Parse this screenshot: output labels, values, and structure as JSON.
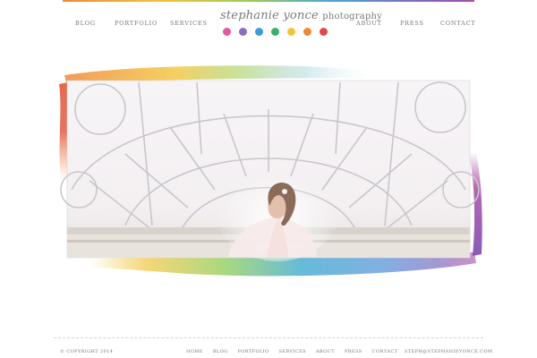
{
  "brand": {
    "name": "stephanie yonce",
    "suffix": "photography",
    "dot_colors": [
      "#e05aa0",
      "#8a6dc0",
      "#3e9ad8",
      "#39b06a",
      "#f2c43a",
      "#f0873a",
      "#e04848"
    ]
  },
  "nav": {
    "left": [
      "BLOG",
      "PORTFOLIO",
      "SERVICES"
    ],
    "right": [
      "ABOUT",
      "PRESS",
      "CONTACT"
    ]
  },
  "footer": {
    "copyright": "© COPYRIGHT 2014",
    "links": [
      "HOME",
      "BLOG",
      "PORTFOLIO",
      "SERVICES",
      "ABOUT",
      "PRESS",
      "CONTACT"
    ],
    "email": "STEPH@STEPHANIEYONCE.COM"
  },
  "colors": {
    "rainbow": [
      "#f08a3a",
      "#f2c43a",
      "#9ccc55",
      "#46b5a0",
      "#4aa6d8",
      "#7b6dc0",
      "#a84aa8"
    ]
  }
}
